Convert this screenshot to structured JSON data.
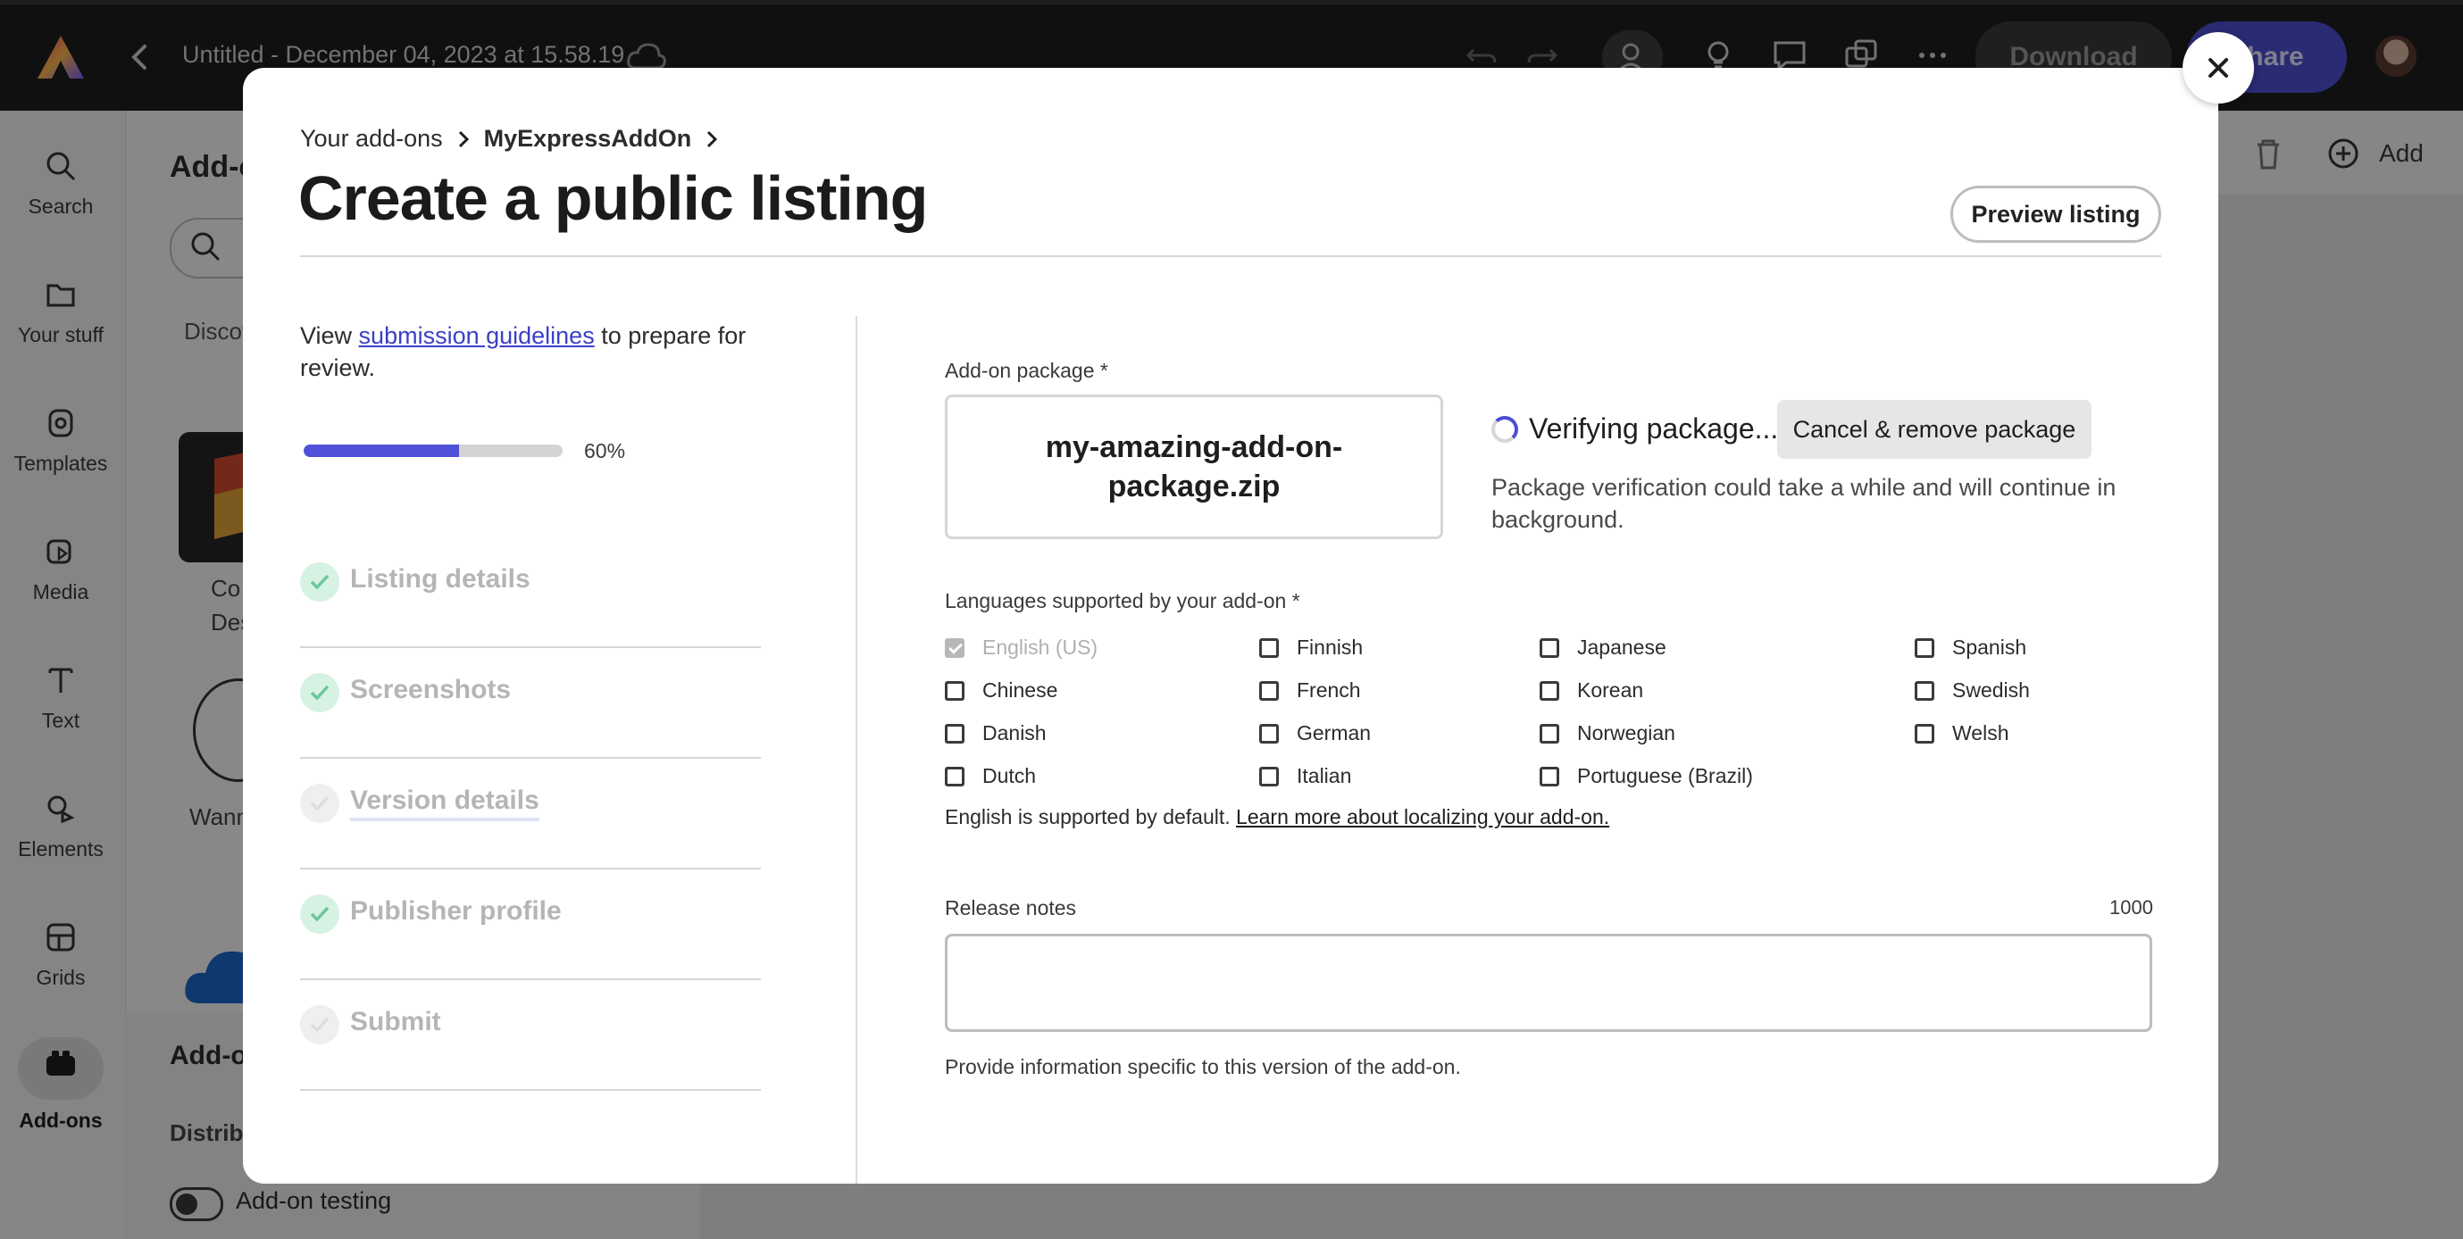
{
  "app": {
    "doc_title": "Untitled - December 04, 2023 at 15.58.19",
    "download_label": "Download",
    "share_label": "Share"
  },
  "rail": {
    "items": [
      {
        "label": "Search",
        "icon": "search-icon"
      },
      {
        "label": "Your stuff",
        "icon": "folder-icon"
      },
      {
        "label": "Templates",
        "icon": "templates-icon"
      },
      {
        "label": "Media",
        "icon": "media-icon"
      },
      {
        "label": "Text",
        "icon": "text-icon"
      },
      {
        "label": "Elements",
        "icon": "elements-icon"
      },
      {
        "label": "Grids",
        "icon": "grids-icon"
      },
      {
        "label": "Add-ons",
        "icon": "addons-icon",
        "active": true
      }
    ]
  },
  "panel": {
    "title": "Add-ons",
    "tab_discover": "Discover",
    "card1_label_line1": "Co",
    "card1_label_line2": "Desi",
    "card2_label": "Wann",
    "lower_title": "Add-ons",
    "lower_subtitle": "Distribute",
    "testing_label": "Add-on testing"
  },
  "canvas": {
    "add_label": "Add"
  },
  "modal": {
    "breadcrumb_root": "Your add-ons",
    "breadcrumb_current": "MyExpressAddOn",
    "title": "Create a public listing",
    "preview_label": "Preview listing",
    "guide_prefix": "View ",
    "guide_link": "submission guidelines",
    "guide_suffix": " to prepare for review.",
    "progress_percent": 60,
    "progress_label": "60%",
    "steps": [
      {
        "label": "Listing details",
        "status": "done"
      },
      {
        "label": "Screenshots",
        "status": "done"
      },
      {
        "label": "Version details",
        "status": "current"
      },
      {
        "label": "Publisher profile",
        "status": "done"
      },
      {
        "label": "Submit",
        "status": "pending"
      }
    ],
    "package": {
      "label": "Add-on package",
      "required_marker": "*",
      "filename_line1": "my-amazing-add-on-",
      "filename_line2": "package.zip",
      "status": "Verifying package...",
      "cancel_label": "Cancel & remove package",
      "note": "Package verification could take a while and will continue in background."
    },
    "languages": {
      "label": "Languages supported by your add-on",
      "required_marker": "*",
      "options": [
        {
          "name": "English (US)",
          "checked": true,
          "disabled": true
        },
        {
          "name": "Chinese",
          "checked": false
        },
        {
          "name": "Danish",
          "checked": false
        },
        {
          "name": "Dutch",
          "checked": false
        },
        {
          "name": "Finnish",
          "checked": false
        },
        {
          "name": "French",
          "checked": false
        },
        {
          "name": "German",
          "checked": false
        },
        {
          "name": "Italian",
          "checked": false
        },
        {
          "name": "Japanese",
          "checked": false
        },
        {
          "name": "Korean",
          "checked": false
        },
        {
          "name": "Norwegian",
          "checked": false
        },
        {
          "name": "Portuguese (Brazil)",
          "checked": false
        },
        {
          "name": "Spanish",
          "checked": false
        },
        {
          "name": "Swedish",
          "checked": false
        },
        {
          "name": "Welsh",
          "checked": false
        }
      ],
      "default_note": "English is supported by default. ",
      "learn_more_link": "Learn more about localizing your add-on."
    },
    "release_notes": {
      "label": "Release notes",
      "counter": "1000",
      "value": "",
      "help": "Provide information specific to this version of the add-on."
    }
  },
  "colors": {
    "accent": "#4b4fd2",
    "progress": "#5050d8",
    "done_check": "#6cc79a",
    "topbar": "#1e1e1e"
  }
}
